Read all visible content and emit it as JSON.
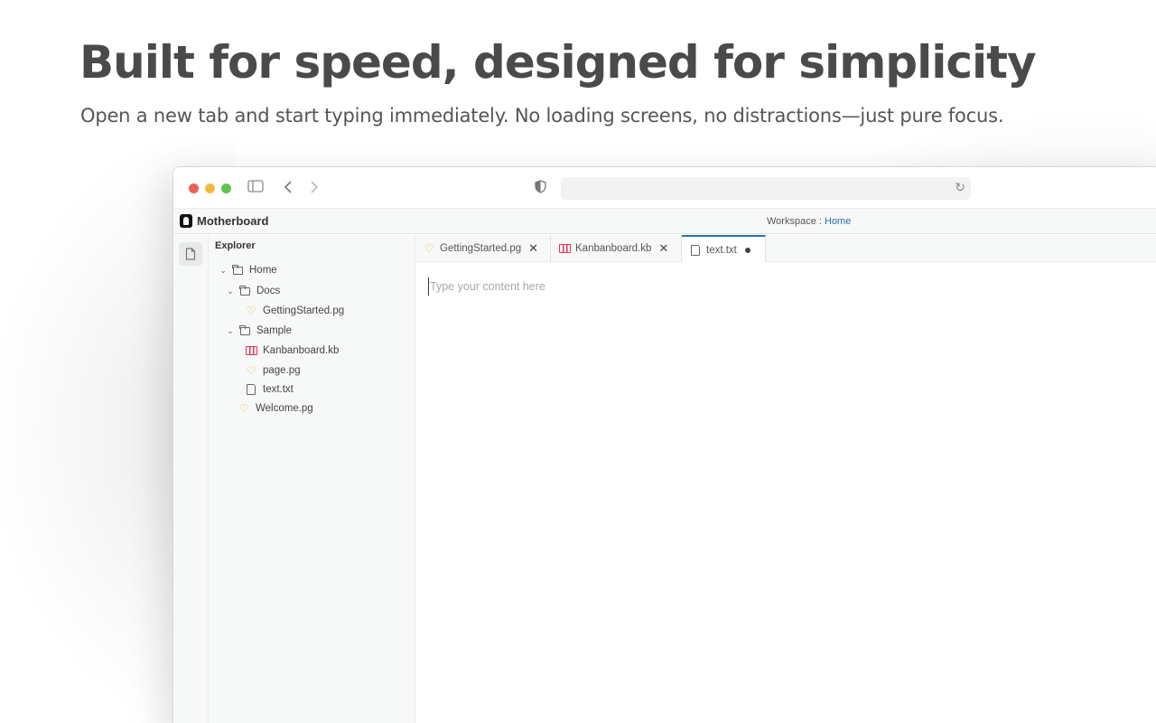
{
  "hero": {
    "title": "Built for speed, designed for simplicity",
    "subtitle": "Open a new tab and start typing immediately. No loading screens, no distractions—just pure focus."
  },
  "browser": {
    "icons": [
      "sidebar-toggle-icon",
      "back-icon",
      "forward-icon",
      "shield-icon",
      "reload-icon"
    ]
  },
  "app": {
    "name": "Motherboard",
    "workspace_label": "Workspace : ",
    "workspace_name": "Home"
  },
  "explorer": {
    "title": "Explorer",
    "tree": [
      {
        "label": "Home",
        "type": "folder",
        "expanded": true,
        "depth": 0
      },
      {
        "label": "Docs",
        "type": "folder",
        "expanded": true,
        "depth": 1
      },
      {
        "label": "GettingStarted.pg",
        "type": "page",
        "depth": 2
      },
      {
        "label": "Sample",
        "type": "folder",
        "expanded": true,
        "depth": 1
      },
      {
        "label": "Kanbanboard.kb",
        "type": "kanban",
        "depth": 2
      },
      {
        "label": "page.pg",
        "type": "page",
        "depth": 2
      },
      {
        "label": "text.txt",
        "type": "text",
        "depth": 2
      },
      {
        "label": "Welcome.pg",
        "type": "page",
        "depth": 1
      }
    ]
  },
  "tabs": [
    {
      "label": "GettingStarted.pg",
      "type": "page",
      "active": false
    },
    {
      "label": "Kanbanboard.kb",
      "type": "kanban",
      "active": false
    },
    {
      "label": "text.txt",
      "type": "text",
      "active": true,
      "unsaved": true
    }
  ],
  "editor": {
    "placeholder": "Type your content here",
    "value": ""
  },
  "colors": {
    "accent": "#2a6fb5",
    "page_icon": "#f0b429",
    "kanban_icon": "#e2335c"
  }
}
